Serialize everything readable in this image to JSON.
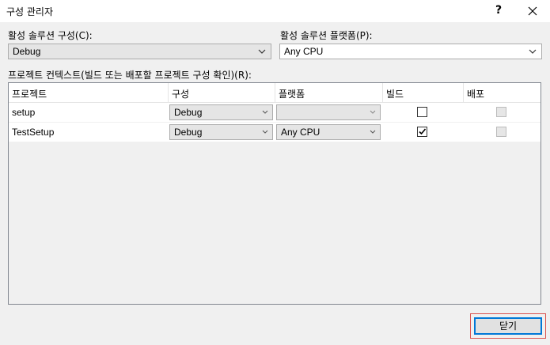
{
  "window": {
    "title": "구성 관리자",
    "help_label": "?"
  },
  "active_config": {
    "label": "활성 솔루션 구성(C):",
    "value": "Debug"
  },
  "active_platform": {
    "label": "활성 솔루션 플랫폼(P):",
    "value": "Any CPU"
  },
  "project_contexts": {
    "label": "프로젝트 컨텍스트(빌드 또는 배포할 프로젝트 구성 확인)(R):",
    "columns": [
      "프로젝트",
      "구성",
      "플랫폼",
      "빌드",
      "배포"
    ],
    "rows": [
      {
        "project": "setup",
        "config": "Debug",
        "platform": "",
        "build": false,
        "deploy": false,
        "deploy_enabled": false
      },
      {
        "project": "TestSetup",
        "config": "Debug",
        "platform": "Any CPU",
        "build": true,
        "deploy": false,
        "deploy_enabled": false
      }
    ]
  },
  "footer": {
    "close_label": "닫기"
  },
  "colors": {
    "accent_border": "#0078d7",
    "highlight_frame": "#d9534f"
  },
  "icons": {
    "close": "close-icon",
    "dropdown": "chevron-down-icon",
    "check": "check-icon"
  }
}
